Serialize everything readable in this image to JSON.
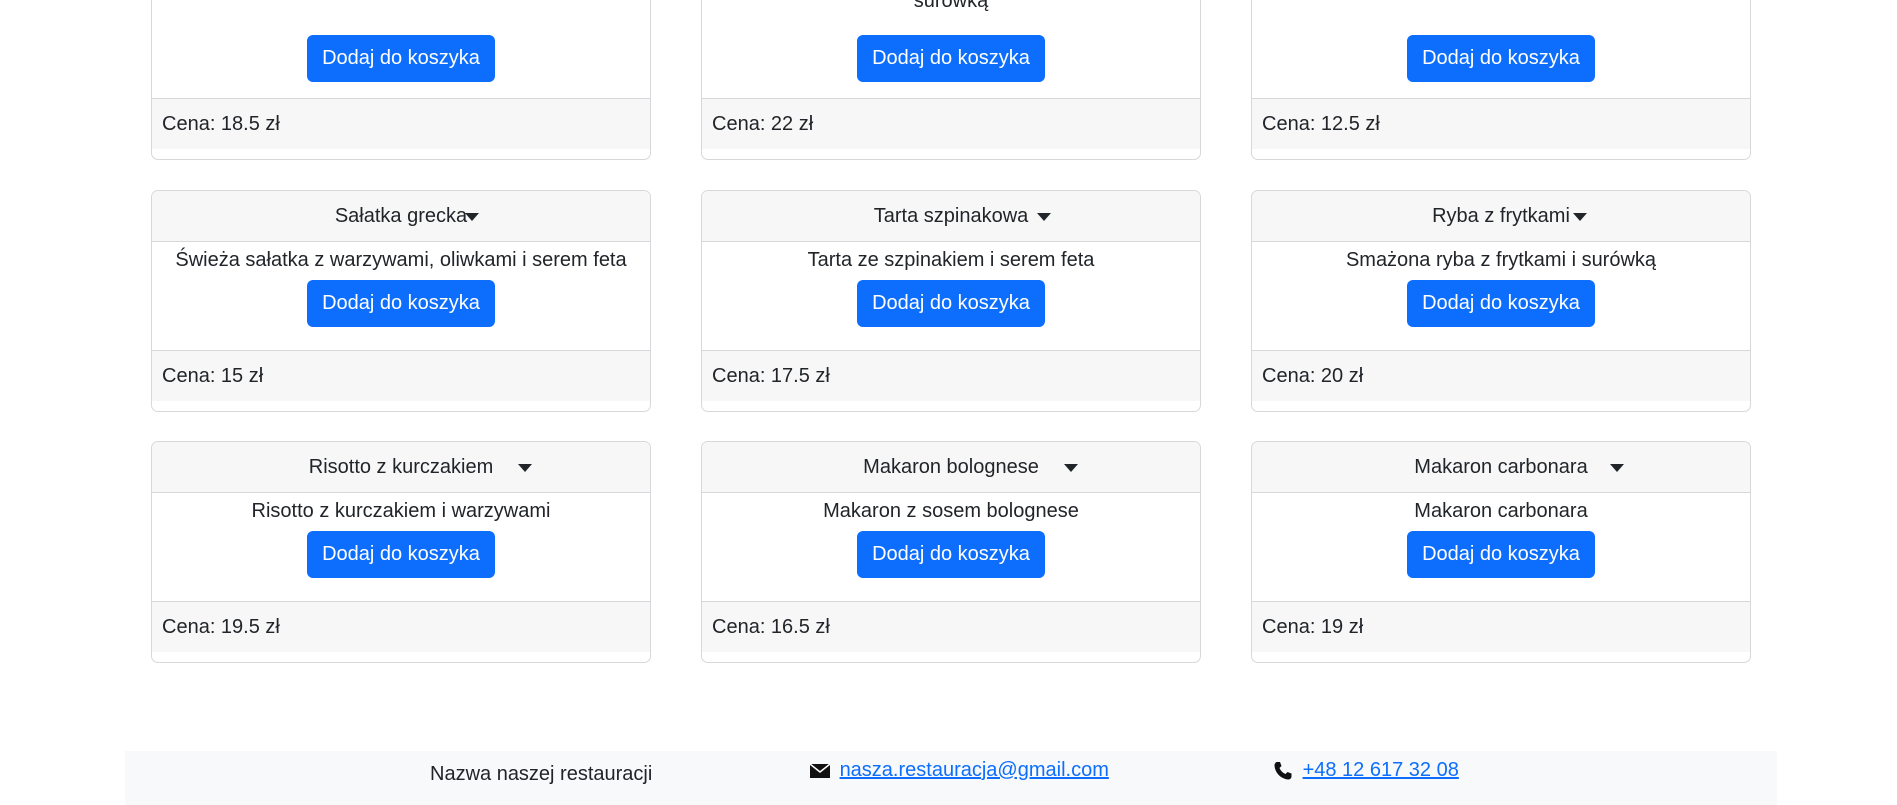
{
  "cards_top": [
    {
      "desc": "",
      "button": "Dodaj do koszyka",
      "price": "Cena: 18.5 zł"
    },
    {
      "desc": "surówką",
      "button": "Dodaj do koszyka",
      "price": "Cena: 22 zł"
    },
    {
      "desc": "",
      "button": "Dodaj do koszyka",
      "price": "Cena: 12.5 zł"
    }
  ],
  "cards": [
    {
      "title": "Sałatka grecka",
      "desc": "Świeża sałatka z warzywami, oliwkami i serem feta",
      "button": "Dodaj do koszyka",
      "price": "Cena: 15 zł"
    },
    {
      "title": "Tarta szpinakowa",
      "desc": "Tarta ze szpinakiem i serem feta",
      "button": "Dodaj do koszyka",
      "price": "Cena: 17.5 zł"
    },
    {
      "title": "Ryba z frytkami",
      "desc": "Smażona ryba z frytkami i surówką",
      "button": "Dodaj do koszyka",
      "price": "Cena: 20 zł"
    },
    {
      "title": "Risotto z kurczakiem",
      "desc": "Risotto z kurczakiem i warzywami",
      "button": "Dodaj do koszyka",
      "price": "Cena: 19.5 zł"
    },
    {
      "title": "Makaron bolognese",
      "desc": "Makaron z sosem bolognese",
      "button": "Dodaj do koszyka",
      "price": "Cena: 16.5 zł"
    },
    {
      "title": "Makaron carbonara",
      "desc": "Makaron carbonara",
      "button": "Dodaj do koszyka",
      "price": "Cena: 19 zł"
    }
  ],
  "footer": {
    "restaurant_name": "Nazwa naszej restauracji",
    "email": "nasza.restauracja@gmail.com",
    "phone": "+48 12 617 32 08",
    "email_icon": "envelope-icon",
    "phone_icon": "phone-icon"
  },
  "colors": {
    "primary": "#0d6efd",
    "header_bg": "#f7f7f7",
    "border": "#d6d8db"
  }
}
